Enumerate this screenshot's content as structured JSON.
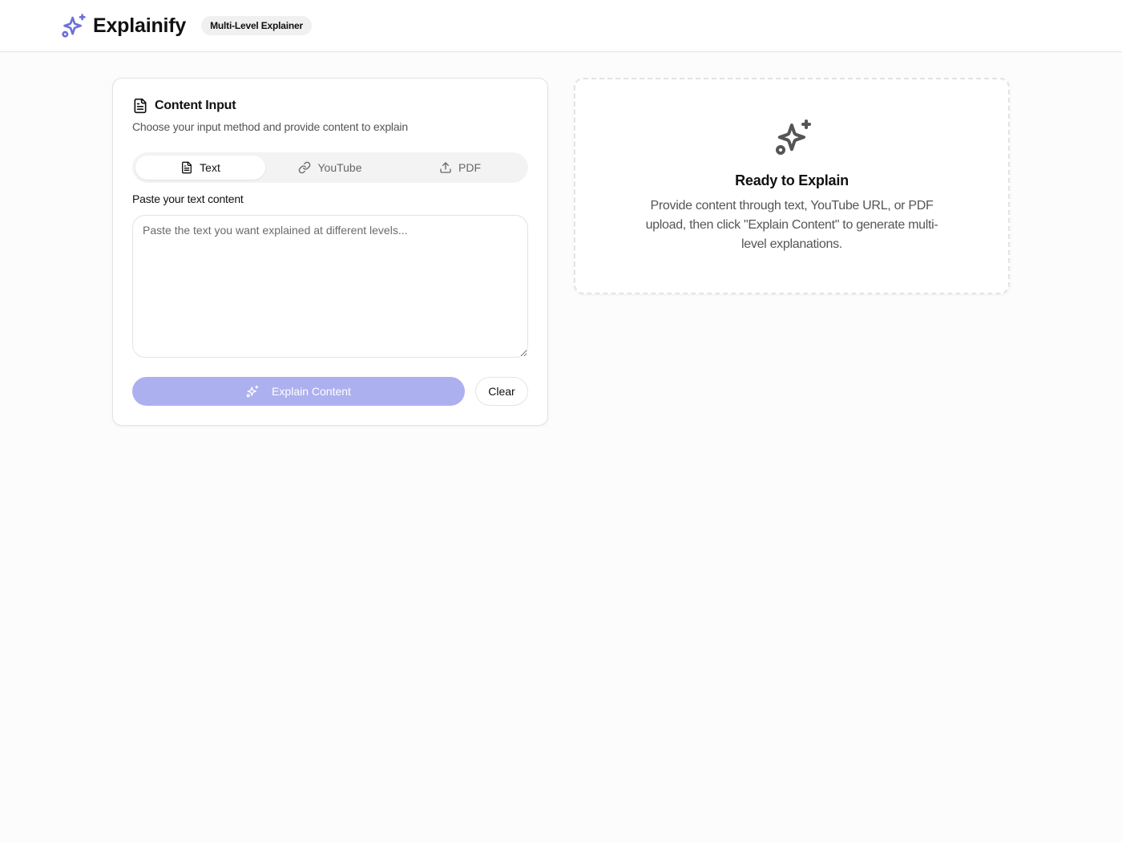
{
  "header": {
    "brand": "Explainify",
    "badge": "Multi-Level Explainer",
    "logo_icon": "sparkles-icon",
    "accent_color": "#6d6fd8"
  },
  "input_card": {
    "icon": "file-text-icon",
    "title": "Content Input",
    "subtitle": "Choose your input method and provide content to explain",
    "tabs": [
      {
        "label": "Text",
        "icon": "file-text-icon",
        "active": true
      },
      {
        "label": "YouTube",
        "icon": "link-icon",
        "active": false
      },
      {
        "label": "PDF",
        "icon": "upload-icon",
        "active": false
      }
    ],
    "field_label": "Paste your text content",
    "textarea": {
      "value": "",
      "placeholder": "Paste the text you want explained at different levels..."
    },
    "explain_button": {
      "label": "Explain Content",
      "icon": "sparkles-icon",
      "color": "#adb0ef"
    },
    "clear_button": {
      "label": "Clear"
    }
  },
  "output_card": {
    "icon": "sparkles-icon",
    "title": "Ready to Explain",
    "description": "Provide content through text, YouTube URL, or PDF upload, then click \"Explain Content\" to generate multi-level explanations."
  }
}
